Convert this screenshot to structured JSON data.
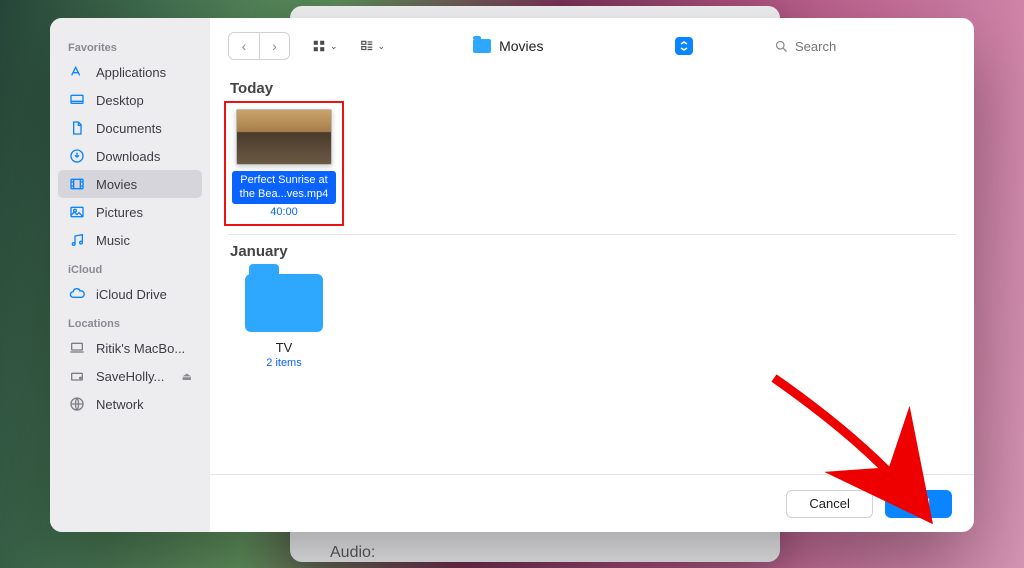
{
  "sidebar": {
    "favorites_heading": "Favorites",
    "icloud_heading": "iCloud",
    "locations_heading": "Locations",
    "items": [
      {
        "label": "Applications"
      },
      {
        "label": "Desktop"
      },
      {
        "label": "Documents"
      },
      {
        "label": "Downloads"
      },
      {
        "label": "Movies"
      },
      {
        "label": "Pictures"
      },
      {
        "label": "Music"
      }
    ],
    "icloud": [
      {
        "label": "iCloud Drive"
      }
    ],
    "locations": [
      {
        "label": "Ritik's MacBo..."
      },
      {
        "label": "SaveHolly..."
      },
      {
        "label": "Network"
      }
    ]
  },
  "toolbar": {
    "location_label": "Movies",
    "search_placeholder": "Search"
  },
  "content": {
    "today_label": "Today",
    "january_label": "January",
    "selected_file": {
      "name": "Perfect Sunrise at the Bea...ves.mp4",
      "duration": "40:00"
    },
    "folder": {
      "name": "TV",
      "meta": "2 items"
    }
  },
  "footer": {
    "cancel": "Cancel",
    "add": "Add"
  },
  "background_window": {
    "field_label": "Audio:"
  }
}
